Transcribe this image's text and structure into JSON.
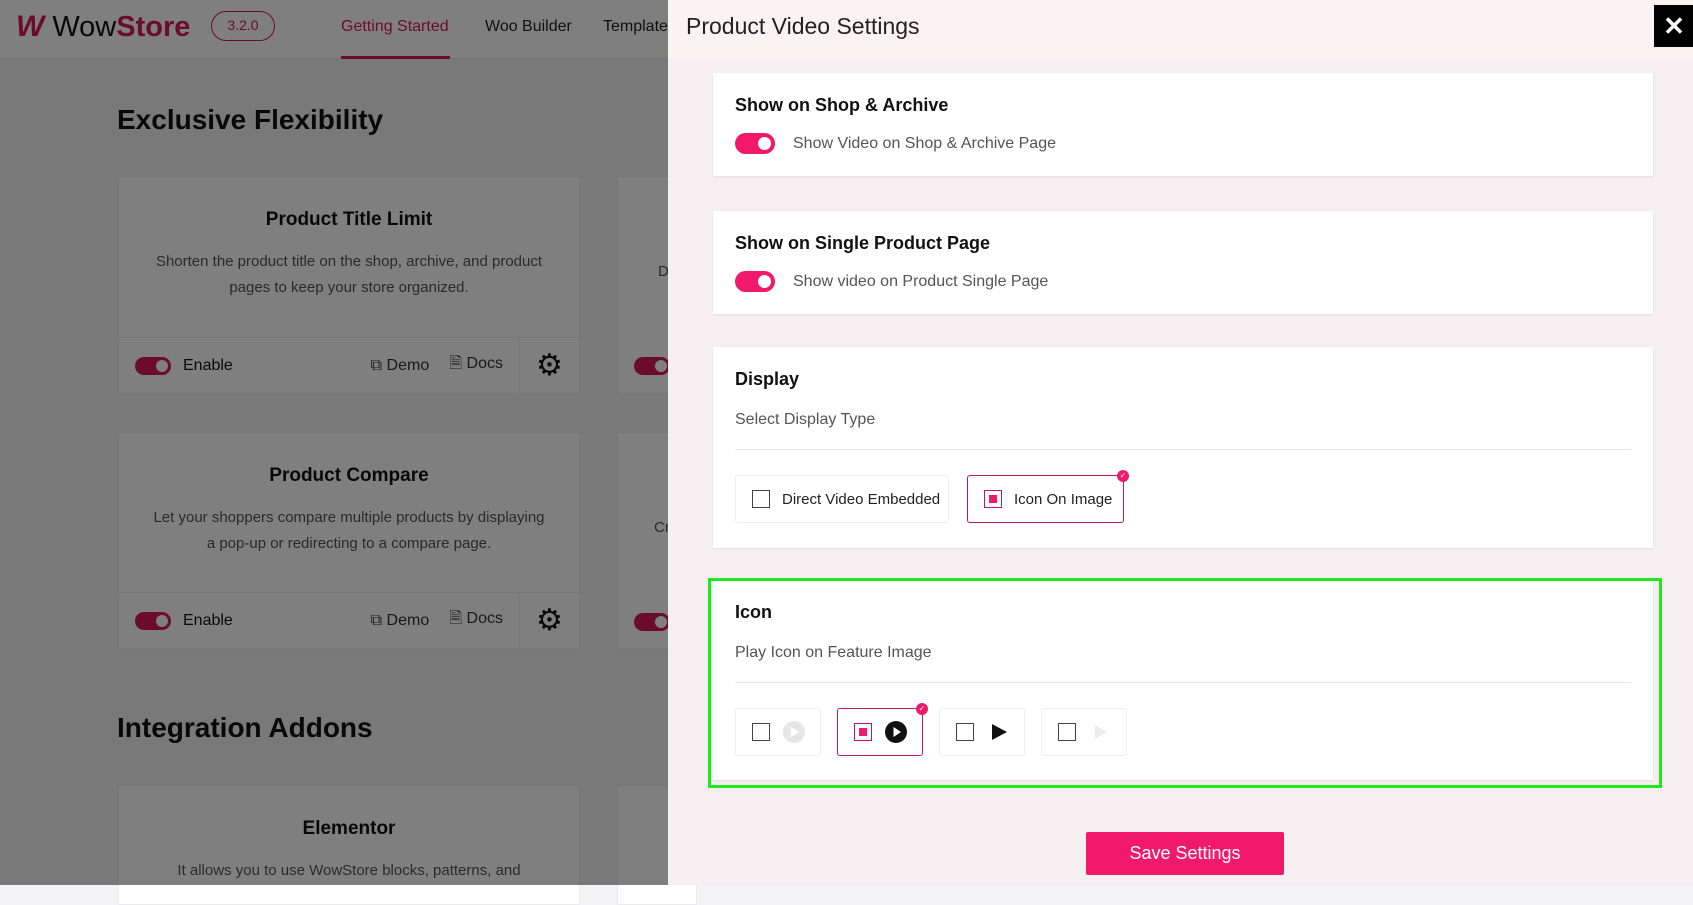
{
  "app": {
    "logo_mark": "W",
    "brand_plain": "Wow",
    "brand_bold": "Store",
    "version": "3.2.0"
  },
  "nav": [
    "Getting Started",
    "Woo Builder",
    "Template"
  ],
  "background": {
    "section1": "Exclusive Flexibility",
    "section2": "Integration Addons",
    "cards": [
      {
        "title": "Product Title Limit",
        "desc": "Shorten the product title on the shop, archive, and product pages to keep your store organized.",
        "enable": "Enable",
        "demo": "Demo",
        "docs": "Docs"
      },
      {
        "title": "Product Compare",
        "desc": "Let your shoppers compare multiple products by displaying a pop-up or redirecting to a compare page.",
        "enable": "Enable",
        "demo": "Demo",
        "docs": "Docs"
      },
      {
        "title": "Elementor",
        "desc": "It allows you to use WowStore blocks, patterns, and"
      }
    ],
    "right_card_fragments": [
      "D",
      "Cr"
    ]
  },
  "panel": {
    "title": "Product Video Settings",
    "close": "✕",
    "shop": {
      "title": "Show on Shop & Archive",
      "toggle_label": "Show Video on Shop & Archive Page",
      "enabled": true
    },
    "single": {
      "title": "Show on Single Product Page",
      "toggle_label": "Show video on Product Single Page",
      "enabled": true
    },
    "display": {
      "title": "Display",
      "subtitle": "Select Display Type",
      "options": [
        "Direct Video Embedded",
        "Icon On Image"
      ],
      "selected": "Icon On Image"
    },
    "icon": {
      "title": "Icon",
      "subtitle": "Play Icon on Feature Image",
      "options": [
        "play-circle-light-icon",
        "play-circle-dark-icon",
        "play-solid-icon",
        "play-light-icon"
      ],
      "selected_index": 1
    },
    "save": "Save Settings"
  },
  "colors": {
    "accent": "#f0196b",
    "brand": "#d6195b",
    "highlight": "#1ee81e"
  }
}
